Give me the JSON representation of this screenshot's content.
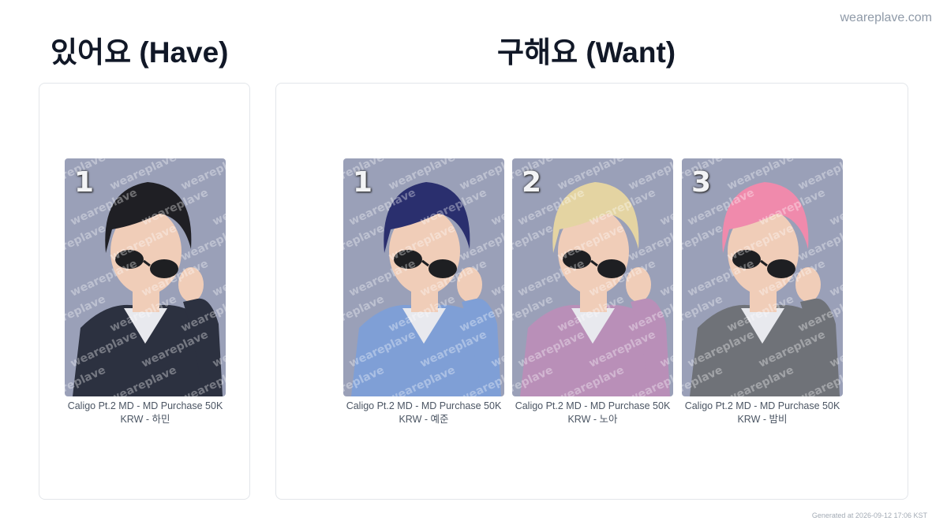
{
  "site": "weareplave.com",
  "have": {
    "heading": "있어요 (Have)",
    "cards": [
      {
        "number": "1",
        "caption": "Caligo Pt.2 MD - MD Purchase 50K KRW - 하민",
        "hair": "#1f1f24",
        "shirt": "#2c3140"
      }
    ]
  },
  "want": {
    "heading": "구해요 (Want)",
    "cards": [
      {
        "number": "1",
        "caption": "Caligo Pt.2 MD - MD Purchase 50K KRW - 예준",
        "hair": "#2a2f6e",
        "shirt": "#7f9fd6"
      },
      {
        "number": "2",
        "caption": "Caligo Pt.2 MD - MD Purchase 50K KRW - 노아",
        "hair": "#e4d4a2",
        "shirt": "#b98fb8"
      },
      {
        "number": "3",
        "caption": "Caligo Pt.2 MD - MD Purchase 50K KRW - 밤비",
        "hair": "#f08aac",
        "shirt": "#6f7278"
      }
    ]
  },
  "watermark": "weareplave",
  "footer": "Generated at 2026-09-12 17:06 KST",
  "colors": {
    "photo_bg": "#9aa0b8",
    "skin": "#f0cdb8",
    "lens": "#1e1f22"
  }
}
